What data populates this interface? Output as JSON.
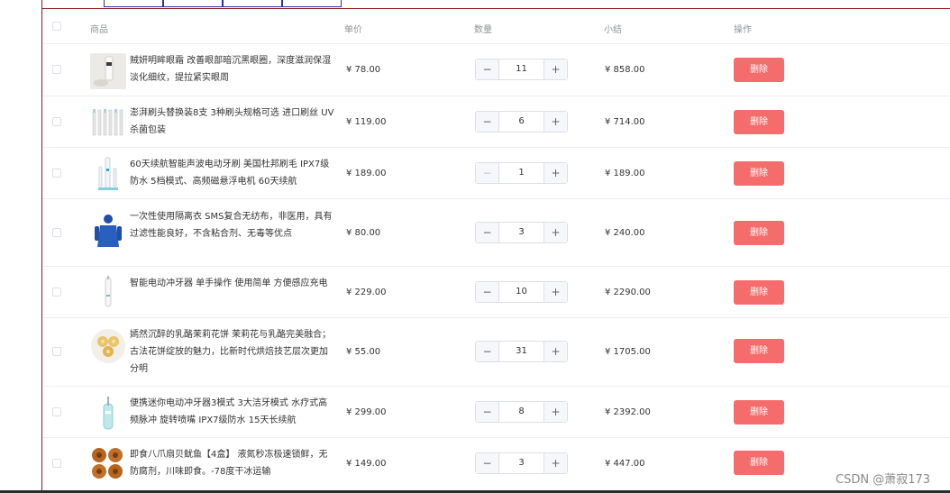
{
  "header": {
    "product": "商品",
    "unit_price": "单价",
    "quantity": "数量",
    "subtotal": "小结",
    "actions": "操作"
  },
  "rows": [
    {
      "name": "贼妍明眸眼霜 改善眼部暗沉黑眼圈，深度滋润保湿淡化细纹，提拉紧实眼周",
      "price": "¥ 78.00",
      "qty": "11",
      "subtotal": "¥ 858.00",
      "delete": "删除",
      "minus_disabled": false,
      "image": "eye-cream"
    },
    {
      "name": "澎湃刷头替换装8支 3种刷头规格可选 进口刷丝 UV杀菌包装",
      "price": "¥ 119.00",
      "qty": "6",
      "subtotal": "¥ 714.00",
      "delete": "删除",
      "minus_disabled": false,
      "image": "brush-heads"
    },
    {
      "name": "60天续航智能声波电动牙刷 美国杜邦刷毛 IPX7级防水 5档模式、高频磁悬浮电机 60天续航",
      "price": "¥ 189.00",
      "qty": "1",
      "subtotal": "¥ 189.00",
      "delete": "删除",
      "minus_disabled": true,
      "image": "electric-toothbrush"
    },
    {
      "name": "一次性使用隔离衣 SMS复合无纺布，非医用，具有过滤性能良好，不含粘合剂、无毒等优点",
      "price": "¥ 80.00",
      "qty": "3",
      "subtotal": "¥ 240.00",
      "delete": "删除",
      "minus_disabled": false,
      "image": "isolation-gown"
    },
    {
      "name": "智能电动冲牙器 单手操作 使用简单 方便感应充电",
      "price": "¥ 229.00",
      "qty": "10",
      "subtotal": "¥ 2290.00",
      "delete": "删除",
      "minus_disabled": false,
      "image": "water-flosser"
    },
    {
      "name": "嫣然沉醉的乳酪茉莉花饼 茉莉花与乳酪完美融合；古法花饼绽放的魅力，比新时代烘焙技艺层次更加分明",
      "price": "¥ 55.00",
      "qty": "31",
      "subtotal": "¥ 1705.00",
      "delete": "删除",
      "minus_disabled": false,
      "image": "flower-cakes"
    },
    {
      "name": "便携迷你电动冲牙器3模式 3大洁牙模式 水疗式高频脉冲 旋转喷嘴 IPX7级防水 15天长续航",
      "price": "¥ 299.00",
      "qty": "8",
      "subtotal": "¥ 2392.00",
      "delete": "删除",
      "minus_disabled": false,
      "image": "mini-flosser"
    },
    {
      "name": "即食八爪扇贝鱿鱼【4盒】 液氮秒冻极速锁鲜，无防腐剂，川味即食。-78度干冰运输",
      "price": "¥ 149.00",
      "qty": "3",
      "subtotal": "¥ 447.00",
      "delete": "删除",
      "minus_disabled": false,
      "image": "seafood-boxes"
    }
  ],
  "stepper": {
    "minus": "−",
    "plus": "+"
  },
  "watermark": "CSDN @萧寂173"
}
